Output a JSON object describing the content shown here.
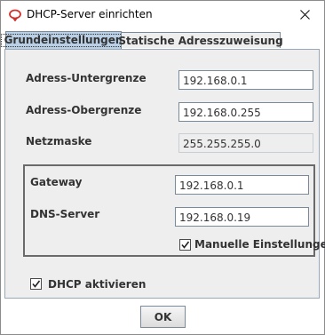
{
  "window": {
    "title": "DHCP-Server einrichten",
    "close_icon": "close-icon",
    "app_icon": "dhcp-app-icon"
  },
  "tabs": [
    {
      "label": "Grundeinstellungen",
      "active": true
    },
    {
      "label": "Statische Adresszuweisung",
      "active": false
    }
  ],
  "form": {
    "lower_address": {
      "label": "Adress-Untergrenze",
      "value": "192.168.0.1"
    },
    "upper_address": {
      "label": "Adress-Obergrenze",
      "value": "192.168.0.255"
    },
    "netmask": {
      "label": "Netzmaske",
      "value": "255.255.255.0"
    },
    "gateway": {
      "label": "Gateway",
      "value": "192.168.0.1"
    },
    "dns_server": {
      "label": "DNS-Server",
      "value": "192.168.0.19"
    },
    "manual_settings": {
      "label": "Manuelle Einstellungen",
      "checked": true
    },
    "dhcp_active": {
      "label": "DHCP aktivieren",
      "checked": true
    }
  },
  "buttons": {
    "ok_label": "OK"
  },
  "colors": {
    "active_tab": "#b8cfe5",
    "panel_bg": "#eeeeee",
    "icon_red": "#d0312d"
  }
}
